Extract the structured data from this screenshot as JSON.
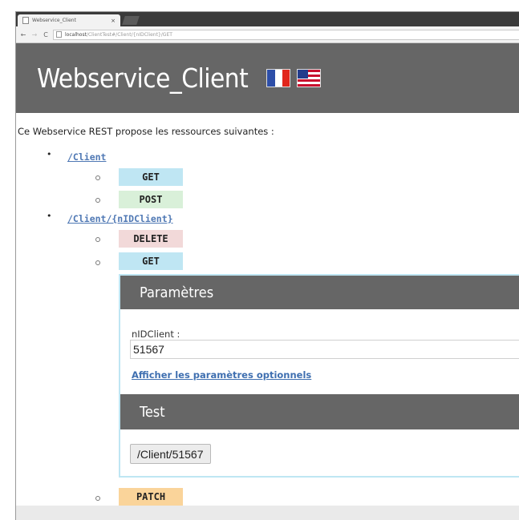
{
  "browser": {
    "tab_title": "Webservice_Client",
    "tab_close": "×",
    "url_host": "localhost",
    "url_path": "/ClientTest#/Client/{nIDClient}/GET",
    "back": "←",
    "forward": "→",
    "reload": "C"
  },
  "header": {
    "title": "Webservice_Client",
    "languages": [
      "fr",
      "en"
    ]
  },
  "intro": "Ce Webservice REST propose les ressources suivantes :",
  "resources": [
    {
      "path": "/Client",
      "methods": [
        "GET",
        "POST"
      ]
    },
    {
      "path": "/Client/{nIDClient}",
      "methods": [
        "DELETE",
        "GET",
        "PATCH"
      ]
    }
  ],
  "panel": {
    "params_title": "Paramètres",
    "field_label": "nIDClient :",
    "field_value": "51567",
    "optional_link": "Afficher les paramètres optionnels",
    "test_title": "Test",
    "test_button": "/Client/51567"
  },
  "colors": {
    "header_bg": "#666666",
    "get": "#bfe6f3",
    "post": "#d9f0d9",
    "delete": "#f2d9d9",
    "patch": "#fad49a",
    "link": "#4f78b4"
  }
}
